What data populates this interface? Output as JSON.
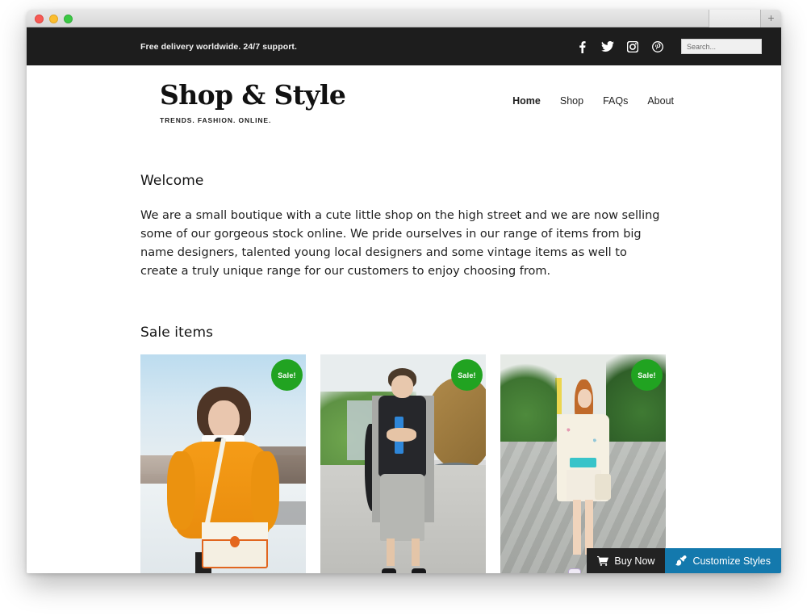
{
  "browser": {
    "traffic_lights": [
      "close",
      "minimize",
      "zoom"
    ],
    "new_tab_label": "+"
  },
  "topbar": {
    "message": "Free delivery worldwide. 24/7 support.",
    "social": [
      {
        "name": "facebook-icon",
        "label": "Facebook"
      },
      {
        "name": "twitter-icon",
        "label": "Twitter"
      },
      {
        "name": "instagram-icon",
        "label": "Instagram"
      },
      {
        "name": "pinterest-icon",
        "label": "Pinterest"
      }
    ],
    "search": {
      "value": "",
      "placeholder": "Search..."
    },
    "background": "#1d1d1d"
  },
  "header": {
    "brand_name": "Shop & Style",
    "tagline": "TRENDS. FASHION. ONLINE.",
    "nav": [
      {
        "label": "Home",
        "active": true
      },
      {
        "label": "Shop",
        "active": false
      },
      {
        "label": "FAQs",
        "active": false
      },
      {
        "label": "About",
        "active": false
      }
    ]
  },
  "welcome": {
    "heading": "Welcome",
    "body": "We are a small boutique with a cute little shop on the high street and we are now selling some of our gorgeous stock online. We pride ourselves in our range of items from big name designers, talented young local designers and some vintage items as well to create a truly unique range for our customers to enjoy choosing from."
  },
  "sale": {
    "heading": "Sale items",
    "badge_label": "Sale!",
    "badge_color": "#21a321",
    "products": [
      {
        "alt": "Woman in orange cable-knit sweater holding a cream and orange handbag on a snowy street"
      },
      {
        "alt": "Man in black top and grey cropped trousers holding a blue bottle beside a bronze sculpture"
      },
      {
        "alt": "Red-haired woman in cream floral jacket and shorts on a tree-lined boulevard"
      }
    ]
  },
  "action_bar": {
    "buy_label": "Buy Now",
    "customize_label": "Customize Styles",
    "buy_color": "#222222",
    "customize_color": "#1479ad"
  }
}
